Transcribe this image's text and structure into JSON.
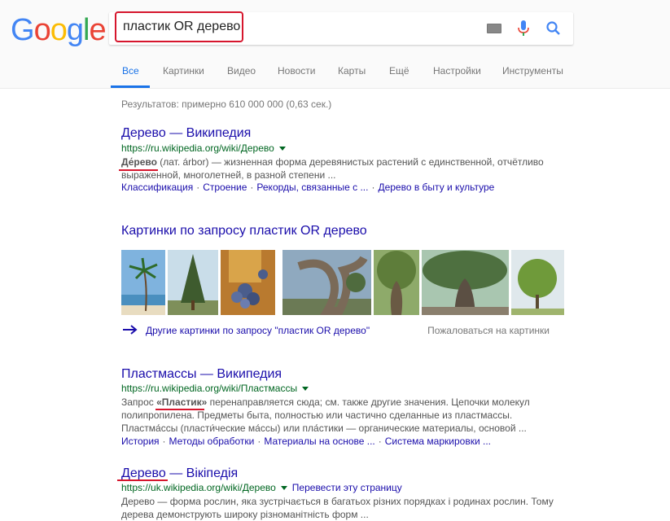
{
  "logo": {
    "text": [
      "G",
      "o",
      "o",
      "g",
      "l",
      "e"
    ],
    "colors": [
      "#4285f4",
      "#ea4335",
      "#fbbc05",
      "#4285f4",
      "#34a853",
      "#ea4335"
    ]
  },
  "search": {
    "query": "пластик OR дерево"
  },
  "tabs": [
    {
      "label": "Все",
      "active": true
    },
    {
      "label": "Картинки"
    },
    {
      "label": "Видео"
    },
    {
      "label": "Новости"
    },
    {
      "label": "Карты"
    },
    {
      "label": "Ещё"
    },
    {
      "label": "Настройки"
    },
    {
      "label": "Инструменты"
    }
  ],
  "stats": "Результатов: примерно 610 000 000 (0,63 сек.)",
  "results": [
    {
      "title": "Дерево — Википедия",
      "url": "https://ru.wikipedia.org/wiki/Дерево",
      "snippet_bold": "Де́рево",
      "snippet": " (лат. árbor) — жизненная форма деревянистых растений с единственной, отчётливо выраженной, многолетней, в разной степени ...",
      "links": [
        "Классификация",
        "Строение",
        "Рекорды, связанные с ...",
        "Дерево в быту и культуре"
      ]
    },
    {
      "title": "Пластмассы — Википедия",
      "url": "https://ru.wikipedia.org/wiki/Пластмассы",
      "snippet_pre": "Запрос ",
      "snippet_bold": "«Пластик»",
      "snippet": " перенаправляется сюда; см. также другие значения. Цепочки молекул полипропилена. Предметы быта, полностью или частично сделанные из пластмассы. Пластма́ссы (пласти́ческие ма́ссы) или пла́стики — органические материалы, основой ...",
      "links": [
        "История",
        "Методы обработки",
        "Материалы на основе ...",
        "Система маркировки ..."
      ]
    },
    {
      "title": "Дерево — Вікіпедія",
      "url": "https://uk.wikipedia.org/wiki/Дерево",
      "translate": "Перевести эту страницу",
      "snippet": "Дерево — форма рослин, яка зустрічається в багатьох різних порядках і родинах рослин. Тому дерева демонструють широку різноманітність форм ..."
    }
  ],
  "images": {
    "heading": "Картинки по запросу пластик OR дерево",
    "more": "Другие картинки по запросу \"пластик OR дерево\"",
    "complain": "Пожаловаться на картинки",
    "thumbs": [
      {
        "name": "palm-tree-beach-image"
      },
      {
        "name": "conifer-tree-image"
      },
      {
        "name": "berries-tree-image"
      },
      {
        "name": "twisted-old-tree-image"
      },
      {
        "name": "gnarled-trunk-tree-image"
      },
      {
        "name": "large-spreading-tree-image"
      },
      {
        "name": "green-round-tree-image"
      }
    ]
  },
  "colors": {
    "link": "#1a0dab",
    "url": "#006621",
    "accent": "#1a73e8",
    "annotation": "#d6162d"
  }
}
